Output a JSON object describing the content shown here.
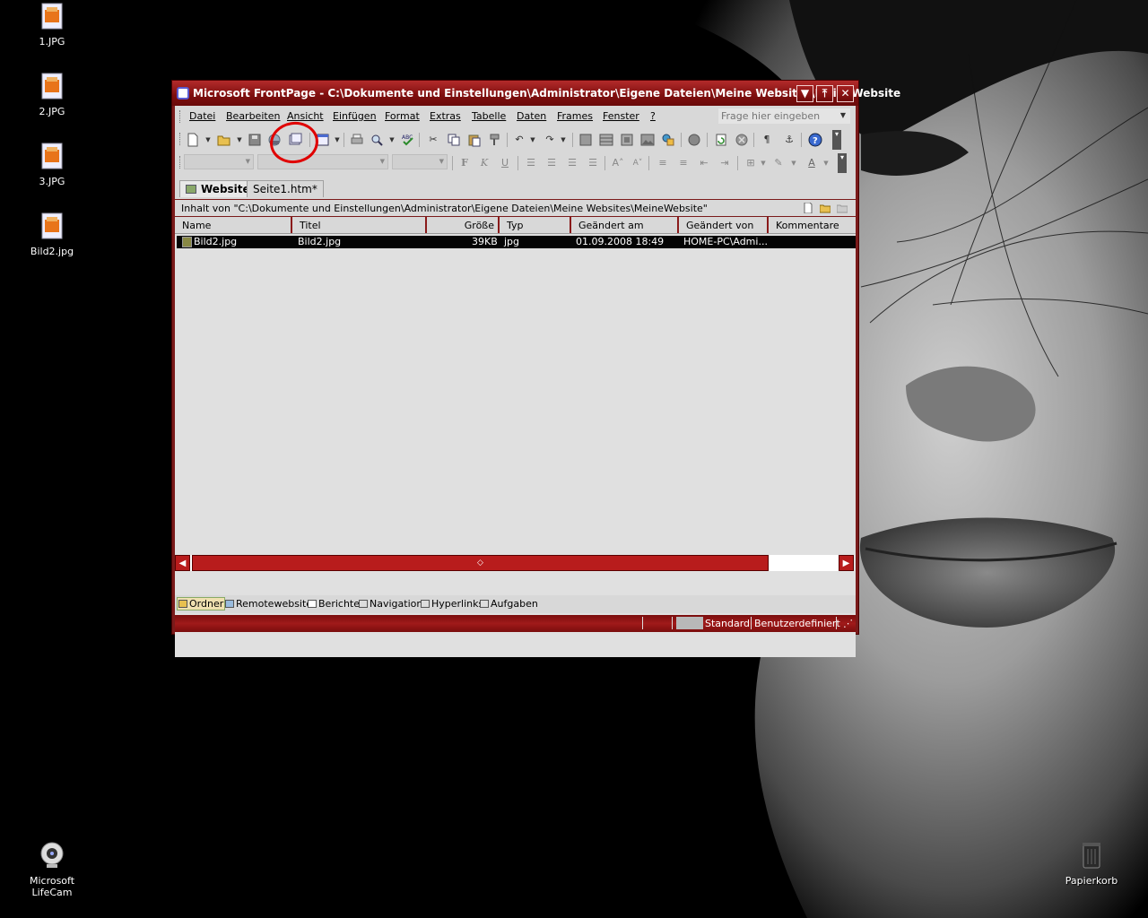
{
  "desktop": {
    "icons": [
      {
        "label": "1.JPG"
      },
      {
        "label": "2.JPG"
      },
      {
        "label": "3.JPG"
      },
      {
        "label": "Bild2.jpg"
      },
      {
        "label": "Microsoft LifeCam"
      },
      {
        "label": "Papierkorb"
      }
    ]
  },
  "window": {
    "title": "Microsoft FrontPage - C:\\Dokumente und Einstellungen\\Administrator\\Eigene Dateien\\Meine Websites\\MeineWebsite",
    "controls": {
      "minimize": "▼",
      "restore": "⤒",
      "close": "✕"
    }
  },
  "menu": {
    "items": [
      "Datei",
      "Bearbeiten",
      "Ansicht",
      "Einfügen",
      "Format",
      "Extras",
      "Tabelle",
      "Daten",
      "Frames",
      "Fenster",
      "?"
    ],
    "help_placeholder": "Frage hier eingeben"
  },
  "formatting": {
    "bold": "F",
    "italic": "K",
    "underline": "U"
  },
  "tabs": [
    "Website",
    "Seite1.htm*"
  ],
  "pathbar": {
    "text": "Inhalt von \"C:\\Dokumente und Einstellungen\\Administrator\\Eigene Dateien\\Meine Websites\\MeineWebsite\""
  },
  "file_list": {
    "columns": [
      "Name",
      "Titel",
      "Größe",
      "Typ",
      "Geändert am",
      "Geändert von",
      "Kommentare"
    ],
    "rows": [
      {
        "name": "Bild2.jpg",
        "title": "Bild2.jpg",
        "size": "39KB",
        "type": "jpg",
        "modified": "01.09.2008 18:49",
        "modified_by": "HOME-PC\\Admi...",
        "comment": ""
      }
    ]
  },
  "views": [
    "Ordner",
    "Remotewebsite",
    "Berichte",
    "Navigation",
    "Hyperlinks",
    "Aufgaben"
  ],
  "statusbar": {
    "mode": "Standard",
    "size": "Benutzerdefiniert"
  },
  "colors": {
    "window_frame": "#7a1a1a",
    "titlebar": "#8d1212",
    "annotation": "#e00000",
    "selection": "#050505"
  }
}
